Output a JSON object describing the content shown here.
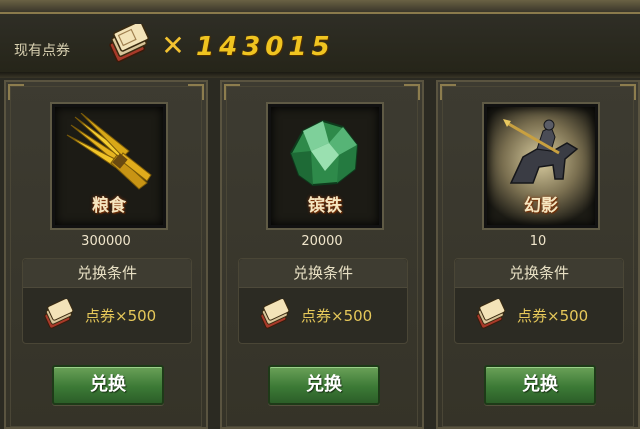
{
  "header": {
    "label": "现有点券",
    "points": "143015",
    "coupon_icon": "coupon-stack-icon",
    "multiply_icon": "times-icon",
    "accent": "#f0c420"
  },
  "items": [
    {
      "name": "粮食",
      "quantity": "300000",
      "icon": "grain-bundle-icon",
      "condition_title": "兑换条件",
      "cost": "点券×500",
      "button": "兑换"
    },
    {
      "name": "镔铁",
      "quantity": "20000",
      "icon": "iron-ore-icon",
      "condition_title": "兑换条件",
      "cost": "点券×500",
      "button": "兑换"
    },
    {
      "name": "幻影",
      "quantity": "10",
      "icon": "phantom-rider-icon",
      "condition_title": "兑换条件",
      "cost": "点券×500",
      "button": "兑换"
    }
  ],
  "colors": {
    "button_green": "#3c7a36",
    "cost_gold": "#e6c85a",
    "panel": "#3d3b31"
  }
}
